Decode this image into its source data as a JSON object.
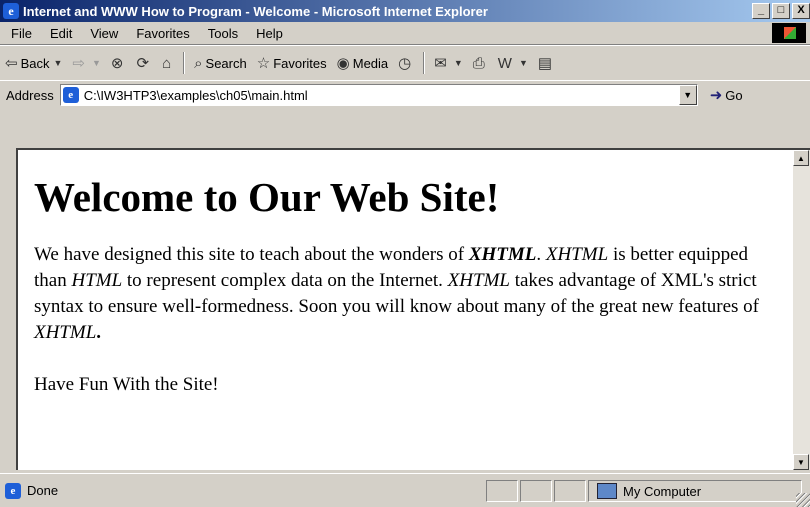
{
  "window": {
    "title": "Internet and WWW How to Program - Welcome - Microsoft Internet Explorer",
    "controls": {
      "minimize": "_",
      "maximize": "□",
      "close": "X"
    }
  },
  "menu": [
    "File",
    "Edit",
    "View",
    "Favorites",
    "Tools",
    "Help"
  ],
  "toolbar": {
    "back": "Back",
    "search": "Search",
    "favorites": "Favorites",
    "media": "Media"
  },
  "address": {
    "label": "Address",
    "url": "C:\\IW3HTP3\\examples\\ch05\\main.html",
    "go": "Go"
  },
  "page": {
    "heading": "Welcome to Our Web Site!",
    "paragraph_parts": [
      {
        "text": "We have designed this site to teach about the wonders of ",
        "style": "normal"
      },
      {
        "text": "XHTML",
        "style": "bold-italic"
      },
      {
        "text": ". ",
        "style": "normal"
      },
      {
        "text": "XHTML",
        "style": "italic"
      },
      {
        "text": " is better equipped than ",
        "style": "normal"
      },
      {
        "text": "HTML",
        "style": "italic"
      },
      {
        "text": " to represent complex data on the Internet. ",
        "style": "normal"
      },
      {
        "text": "XHTML",
        "style": "italic"
      },
      {
        "text": " takes advantage of XML's strict syntax to ensure well-formedness. Soon you will know about many of the great new features of ",
        "style": "normal"
      },
      {
        "text": "XHTML",
        "style": "italic"
      },
      {
        "text": ".",
        "style": "normal"
      }
    ],
    "closing": "Have Fun With the Site!"
  },
  "status": {
    "text": "Done",
    "zone": "My Computer"
  }
}
